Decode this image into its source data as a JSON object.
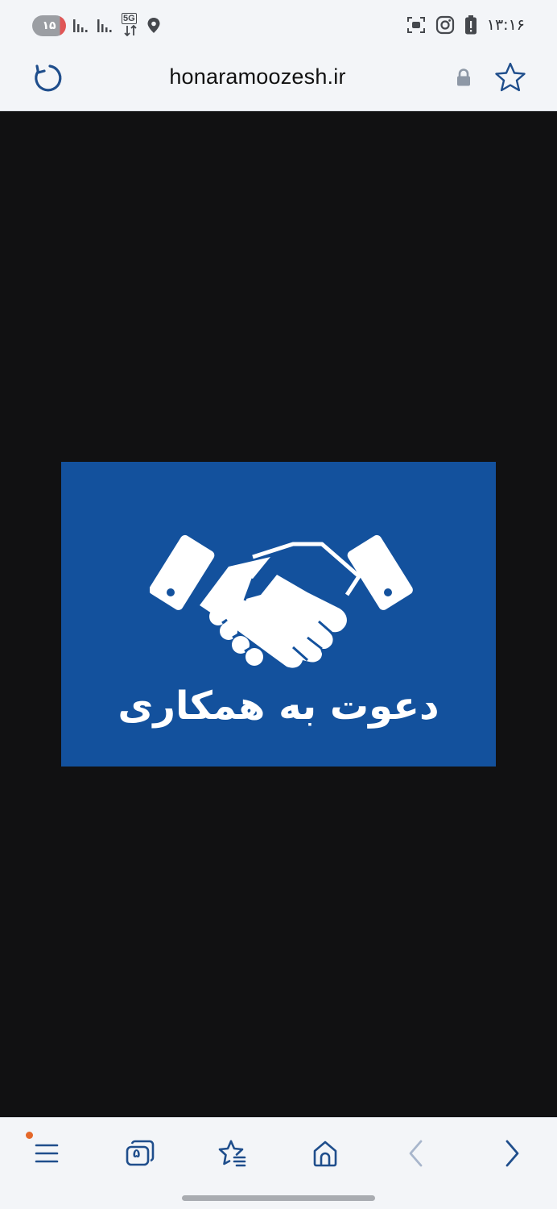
{
  "status_bar": {
    "notification_count": "۱۵",
    "network_label": "5G",
    "time": "۱۳:۱۶"
  },
  "address_bar": {
    "url": "honaramoozesh.ir"
  },
  "banner": {
    "text": "دعوت به همکاری",
    "background_color": "#13519d"
  },
  "bottom_nav": {
    "tab_count": "۵",
    "items": [
      "menu-icon",
      "tabs-icon",
      "bookmarks-icon",
      "home-icon",
      "back-icon",
      "forward-icon"
    ]
  },
  "colors": {
    "accent": "#1f4e8c",
    "notification_dot": "#e4682a"
  }
}
